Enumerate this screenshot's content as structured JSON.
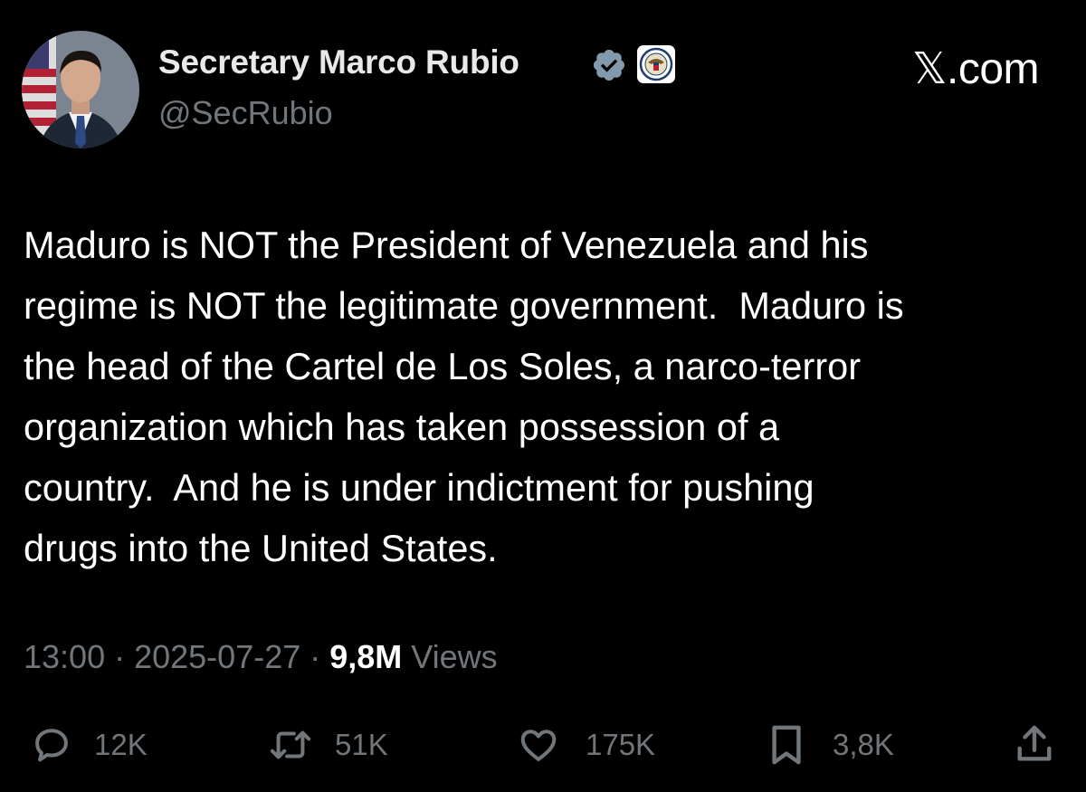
{
  "author": {
    "display_name": "Secretary Marco Rubio",
    "handle": "@SecRubio"
  },
  "site": "𝕏.com",
  "tweet": {
    "lines": [
      "Maduro is NOT the President of Venezuela and his",
      "regime is NOT the legitimate government.  Maduro is",
      "the head of the Cartel de Los Soles, a narco-terror",
      "organization which has taken possession of a",
      "country.  And he is under indictment for pushing",
      "drugs into the United States."
    ]
  },
  "meta": {
    "time": "13:00",
    "separator": " · ",
    "date": "2025-07-27",
    "views_count": "9,8M",
    "views_label": " Views"
  },
  "actions": {
    "replies": "12K",
    "reposts": "51K",
    "likes": "175K",
    "bookmarks": "3,8K"
  },
  "icons": {
    "reply": "reply-icon",
    "repost": "repost-icon",
    "like": "heart-icon",
    "bookmark": "bookmark-icon",
    "share": "share-icon",
    "verified": "verified-badge-icon",
    "affiliation": "state-department-seal-icon"
  },
  "colors": {
    "background": "#000000",
    "text_primary": "#e7e9ea",
    "text_secondary": "#71767b",
    "verified_badge": "#829aab"
  }
}
